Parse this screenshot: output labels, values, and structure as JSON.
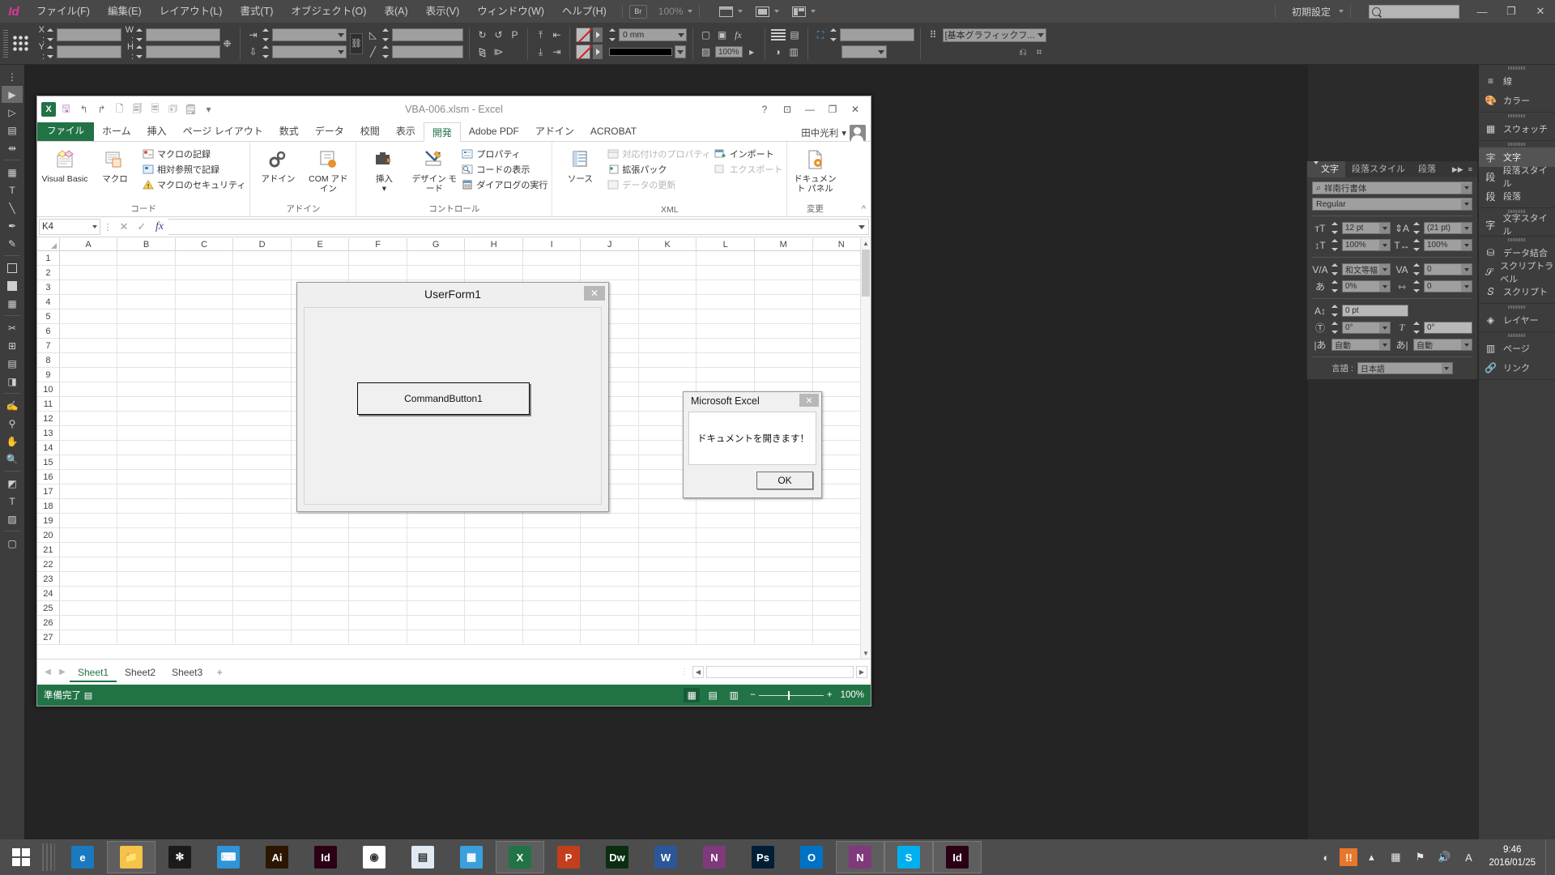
{
  "indesign": {
    "app_name": "Id",
    "menubar": [
      "ファイル(F)",
      "編集(E)",
      "レイアウト(L)",
      "書式(T)",
      "オブジェクト(O)",
      "表(A)",
      "表示(V)",
      "ウィンドウ(W)",
      "ヘルプ(H)"
    ],
    "bridge_label": "Br",
    "zoom_level": "100%",
    "workspace_preset": "初期設定",
    "search_placeholder": "",
    "window_buttons": [
      "—",
      "❐",
      "✕"
    ],
    "controlbar": {
      "x_label": "X :",
      "y_label": "Y :",
      "w_label": "W :",
      "h_label": "H :",
      "x_value": "",
      "y_value": "",
      "w_value": "",
      "h_value": "",
      "rotate_value": "",
      "shear_value": "",
      "stroke_weight": "0 mm",
      "opacity": "100%",
      "fx_label": "fx",
      "object_style": "[基本グラフィックフ...",
      "letter_p": "P"
    },
    "rail": [
      {
        "label": "線",
        "icon": "stroke-icon"
      },
      {
        "label": "カラー",
        "icon": "color-icon"
      },
      {
        "label": "スウォッチ",
        "icon": "swatches-icon"
      },
      {
        "label": "文字",
        "icon": "character-icon",
        "active": true
      },
      {
        "label": "段落スタイル",
        "icon": "paragraph-style-icon"
      },
      {
        "label": "段落",
        "icon": "paragraph-icon"
      },
      {
        "label": "文字スタイル",
        "icon": "character-style-icon"
      },
      {
        "label": "データ結合",
        "icon": "data-merge-icon"
      },
      {
        "label": "スクリプトラベル",
        "icon": "script-label-icon"
      },
      {
        "label": "スクリプト",
        "icon": "script-icon"
      },
      {
        "label": "レイヤー",
        "icon": "layers-icon"
      },
      {
        "label": "ページ",
        "icon": "pages-icon"
      },
      {
        "label": "リンク",
        "icon": "links-icon"
      }
    ],
    "character_panel": {
      "tabs": [
        "文字",
        "段落スタイル",
        "段落"
      ],
      "active_tab": "文字",
      "font_family": "祥南行書体",
      "font_style": "Regular",
      "font_size": "12 pt",
      "leading": "(21 pt)",
      "vertical_scale": "100%",
      "horizontal_scale": "100%",
      "kerning": "和文等幅",
      "tracking": "0",
      "tsume": "0%",
      "aki": "0",
      "baseline_shift": "0 pt",
      "character_rotation": "0°",
      "skew": "0°",
      "left_aki": "自動",
      "right_aki": "自動",
      "language_label": "言語 :",
      "language_value": "日本語"
    }
  },
  "excel": {
    "title": "VBA-006.xlsm - Excel",
    "quick_access": [
      "save-icon",
      "undo-icon",
      "redo-icon",
      "new-icon",
      "print-preview-icon",
      "quick-print-icon",
      "email-icon",
      "customize-icon"
    ],
    "window_buttons": [
      "?",
      "⊡",
      "—",
      "❐",
      "✕"
    ],
    "tabs": [
      "ファイル",
      "ホーム",
      "挿入",
      "ページ レイアウト",
      "数式",
      "データ",
      "校閲",
      "表示",
      "開発",
      "Adobe PDF",
      "アドイン",
      "ACROBAT"
    ],
    "active_tab": "開発",
    "user_name": "田中光利",
    "ribbon_groups": [
      {
        "name": "コード",
        "big": [
          {
            "label": "Visual Basic",
            "icon": "visual-basic-icon"
          },
          {
            "label": "マクロ",
            "icon": "macro-icon"
          }
        ],
        "small": [
          {
            "label": "マクロの記録",
            "icon": "record-macro-icon",
            "disabled": false
          },
          {
            "label": "相対参照で記録",
            "icon": "relative-ref-icon",
            "disabled": false
          },
          {
            "label": "マクロのセキュリティ",
            "icon": "macro-security-icon",
            "disabled": false
          }
        ]
      },
      {
        "name": "アドイン",
        "big": [
          {
            "label": "アドイン",
            "icon": "addins-icon"
          },
          {
            "label": "COM アドイン",
            "icon": "com-addins-icon"
          }
        ],
        "small": []
      },
      {
        "name": "コントロール",
        "big": [
          {
            "label": "挿入",
            "icon": "insert-control-icon"
          },
          {
            "label": "デザイン モード",
            "icon": "design-mode-icon"
          }
        ],
        "small": [
          {
            "label": "プロパティ",
            "icon": "properties-icon",
            "disabled": false
          },
          {
            "label": "コードの表示",
            "icon": "view-code-icon",
            "disabled": false
          },
          {
            "label": "ダイアログの実行",
            "icon": "run-dialog-icon",
            "disabled": false
          }
        ]
      },
      {
        "name": "XML",
        "big": [
          {
            "label": "ソース",
            "icon": "xml-source-icon"
          }
        ],
        "small": [
          {
            "label": "対応付けのプロパティ",
            "icon": "map-properties-icon",
            "disabled": true
          },
          {
            "label": "拡張パック",
            "icon": "expansion-pack-icon",
            "disabled": false
          },
          {
            "label": "データの更新",
            "icon": "refresh-data-icon",
            "disabled": true
          },
          {
            "label": "インポート",
            "icon": "import-icon",
            "disabled": false
          },
          {
            "label": "エクスポート",
            "icon": "export-icon",
            "disabled": true
          }
        ]
      },
      {
        "name": "変更",
        "big": [
          {
            "label": "ドキュメント パネル",
            "icon": "document-panel-icon"
          }
        ],
        "small": []
      }
    ],
    "formula_bar": {
      "name_box": "K4",
      "cancel_icon": "cancel-icon",
      "enter_icon": "enter-icon",
      "fx_icon": "fx",
      "value": ""
    },
    "grid": {
      "columns": [
        "A",
        "B",
        "C",
        "D",
        "E",
        "F",
        "G",
        "H",
        "I",
        "J",
        "K",
        "L",
        "M",
        "N"
      ],
      "rows": [
        1,
        2,
        3,
        4,
        5,
        6,
        7,
        8,
        9,
        10,
        11,
        12,
        13,
        14,
        15,
        16,
        17,
        18,
        19,
        20,
        21,
        22,
        23,
        24,
        25,
        26,
        27
      ]
    },
    "sheet_tabs": [
      "Sheet1",
      "Sheet2",
      "Sheet3"
    ],
    "active_sheet": "Sheet1",
    "add_sheet_label": "+",
    "status": {
      "text": "準備完了",
      "zoom": "100%",
      "views": [
        "normal-view-icon",
        "page-layout-view-icon",
        "page-break-view-icon"
      ]
    }
  },
  "userform": {
    "title": "UserForm1",
    "close_label": "✕",
    "button_label": "CommandButton1"
  },
  "msgbox": {
    "title": "Microsoft Excel",
    "close_label": "✕",
    "message": "ドキュメントを開きます！",
    "ok_label": "OK"
  },
  "taskbar": {
    "start_label": "start-button",
    "apps": [
      {
        "name": "internet-explorer",
        "label": "e",
        "color": "#1a7ac0",
        "boxed": false
      },
      {
        "name": "file-explorer",
        "label": "📁",
        "color": "#f5c24a",
        "boxed": true
      },
      {
        "name": "app-black",
        "label": "✻",
        "color": "#1b1b1b",
        "boxed": false
      },
      {
        "name": "app-blue",
        "label": "⌨",
        "color": "#2f95d8",
        "boxed": false
      },
      {
        "name": "illustrator",
        "label": "Ai",
        "color": "#2b1700",
        "boxed": false
      },
      {
        "name": "indesign",
        "label": "Id",
        "color": "#2b0016",
        "boxed": false
      },
      {
        "name": "chrome",
        "label": "◉",
        "color": "#ffffff",
        "boxed": false
      },
      {
        "name": "notepad",
        "label": "▤",
        "color": "#dfeaf2",
        "boxed": false
      },
      {
        "name": "app-photo",
        "label": "▦",
        "color": "#3aa0dd",
        "boxed": false
      },
      {
        "name": "excel",
        "label": "X",
        "color": "#217346",
        "boxed": true
      },
      {
        "name": "powerpoint",
        "label": "P",
        "color": "#c43e1c",
        "boxed": false
      },
      {
        "name": "dreamweaver",
        "label": "Dw",
        "color": "#0b2e13",
        "boxed": false
      },
      {
        "name": "word",
        "label": "W",
        "color": "#2b579a",
        "boxed": false
      },
      {
        "name": "onenote",
        "label": "N",
        "color": "#80397b",
        "boxed": false
      },
      {
        "name": "photoshop",
        "label": "Ps",
        "color": "#001e36",
        "boxed": false
      },
      {
        "name": "outlook",
        "label": "O",
        "color": "#0072c6",
        "boxed": false
      },
      {
        "name": "onenote-clipper",
        "label": "N",
        "color": "#80397b",
        "boxed": true
      },
      {
        "name": "skype",
        "label": "S",
        "color": "#00aff0",
        "boxed": true
      },
      {
        "name": "indesign-open",
        "label": "Id",
        "color": "#2b0016",
        "boxed": true
      }
    ],
    "tray_icons": [
      "action-center-icon",
      "show-hidden-icon",
      "network-icon",
      "flag-icon",
      "volume-icon",
      "ime-icon"
    ],
    "ime_label": "A",
    "clock_time": "9:46",
    "clock_date": "2016/01/25"
  }
}
